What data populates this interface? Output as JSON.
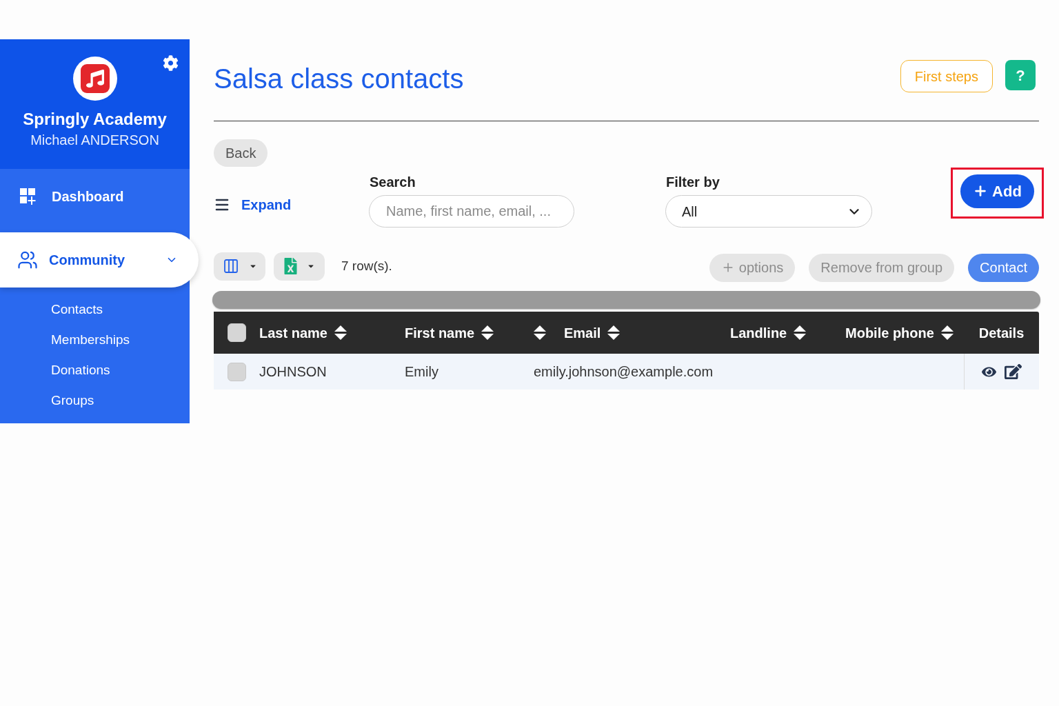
{
  "sidebar": {
    "brand": "Springly Academy",
    "user": "Michael ANDERSON",
    "nav": [
      {
        "label": "Dashboard",
        "kind": "dashboard",
        "selected": false
      },
      {
        "label": "Community",
        "kind": "community",
        "selected": true,
        "expanded": true,
        "children": [
          {
            "label": "Contacts",
            "selected": false
          },
          {
            "label": "Memberships",
            "selected": false
          },
          {
            "label": "Donations",
            "selected": false
          },
          {
            "label": "Groups",
            "selected": false
          }
        ]
      }
    ]
  },
  "header": {
    "title": "Salsa class contacts",
    "first_steps": "First steps",
    "help": "?"
  },
  "back_button": "Back",
  "controls": {
    "expand": "Expand",
    "search": {
      "label": "Search",
      "placeholder": "Name, first name, email, ..."
    },
    "filter": {
      "label": "Filter by",
      "value": "All"
    },
    "add": {
      "label": "Add",
      "highlighted": true
    }
  },
  "toolbar": {
    "row_count": "7 row(s).",
    "buttons": [
      {
        "label": "options",
        "kind": "secondary",
        "plus": true,
        "disabled": true
      },
      {
        "label": "Remove from group",
        "kind": "secondary",
        "plus": false,
        "disabled": true
      },
      {
        "label": "Contact",
        "kind": "primary",
        "plus": false,
        "disabled": true
      }
    ]
  },
  "table": {
    "select_all_checked": false,
    "columns": [
      {
        "label": "Last name",
        "sortable": true
      },
      {
        "label": "First name",
        "sortable": true
      },
      {
        "sortable": true
      },
      {
        "label": "Email",
        "sortable": true
      },
      {
        "label": "Landline",
        "sortable": true
      },
      {
        "label": "Mobile phone",
        "sortable": true
      },
      {
        "label": "Details",
        "sortable": false
      }
    ],
    "rows": [
      {
        "checked": false,
        "last_name": "JOHNSON",
        "first_name": "Emily",
        "email": "emily.johnson@example.com"
      }
    ]
  }
}
